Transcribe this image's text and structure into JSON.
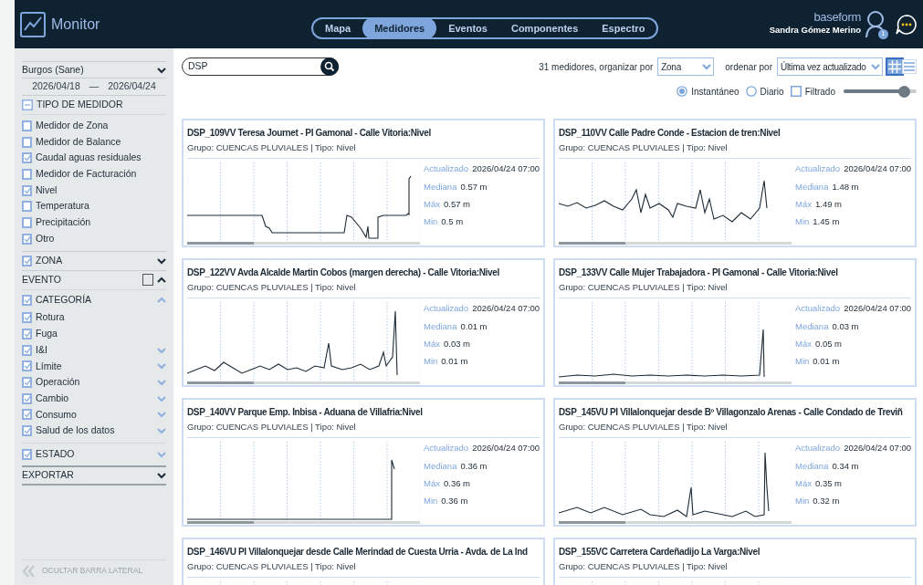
{
  "header": {
    "app_title": "Monitor",
    "nav": [
      {
        "label": "Mapa",
        "selected": false
      },
      {
        "label": "Medidores",
        "selected": true
      },
      {
        "label": "Eventos",
        "selected": false
      },
      {
        "label": "Componentes",
        "selected": false
      },
      {
        "label": "Espectro",
        "selected": false
      }
    ],
    "brand": "baseform",
    "user_name": "Sandra Gómez Merino",
    "notification_count": "1"
  },
  "sidebar": {
    "location": "Burgos (Sane)",
    "date_from": "2026/04/18",
    "date_separator": "—",
    "date_to": "2026/04/24",
    "meter_type": {
      "label": "TIPO DE MEDIDOR",
      "items": [
        {
          "label": "Medidor de Zona",
          "checked": false
        },
        {
          "label": "Medidor de Balance",
          "checked": false
        },
        {
          "label": "Caudal aguas residuales",
          "checked": true
        },
        {
          "label": "Medidor de Facturación",
          "checked": false
        },
        {
          "label": "Nivel",
          "checked": true
        },
        {
          "label": "Temperatura",
          "checked": false
        },
        {
          "label": "Precipitación",
          "checked": false
        },
        {
          "label": "Otro",
          "checked": true
        }
      ]
    },
    "zone": {
      "label": "ZONA",
      "checked": true
    },
    "event": {
      "label": "EVENTO",
      "checked": false
    },
    "category": {
      "label": "CATEGORÍA",
      "checked": true,
      "items": [
        {
          "label": "Rotura",
          "checked": true,
          "expandable": false
        },
        {
          "label": "Fuga",
          "checked": true,
          "expandable": false
        },
        {
          "label": "I&I",
          "checked": true,
          "expandable": true
        },
        {
          "label": "Límite",
          "checked": true,
          "expandable": true
        },
        {
          "label": "Operación",
          "checked": true,
          "expandable": true
        },
        {
          "label": "Cambio",
          "checked": true,
          "expandable": true
        },
        {
          "label": "Consumo",
          "checked": true,
          "expandable": true
        },
        {
          "label": "Salud de los datos",
          "checked": true,
          "expandable": true
        }
      ]
    },
    "status": {
      "label": "ESTADO",
      "checked": true
    },
    "export": {
      "label": "EXPORTAR"
    },
    "hide_sidebar": "OCULTAR BARRA LATERAL"
  },
  "toolbar": {
    "search": {
      "value": "DSP"
    },
    "count_label": "31 medidores, organizar por",
    "group_by": "Zona",
    "sort_label": "ordenar por",
    "sort_by": "Última vez actualizado",
    "view_modes": [
      {
        "kind": "grid",
        "selected": true
      },
      {
        "kind": "list",
        "selected": false
      }
    ],
    "modes": [
      {
        "kind": "radio",
        "label": "Instantáneo",
        "selected": true
      },
      {
        "kind": "radio",
        "label": "Diario",
        "selected": false
      },
      {
        "kind": "checkbox",
        "label": "Filtrado",
        "checked": false
      }
    ],
    "slider": {
      "level": 0.82
    }
  },
  "cards": [
    {
      "title": "DSP_109VV Teresa Journet - PI Gamonal - Calle Vitoria:Nivel",
      "subtitle": "Grupo: CUENCAS PLUVIALES | Tipo: Nivel",
      "stats": [
        {
          "label": "Actualizado",
          "value": "2026/04/24 07:00"
        },
        {
          "label": "Mediana",
          "value": "0.57 m"
        },
        {
          "label": "Máx",
          "value": "0.57 m"
        },
        {
          "label": "Min",
          "value": "0.5 m"
        }
      ]
    },
    {
      "title": "DSP_110VV Calle Padre Conde - Estacion de tren:Nivel",
      "subtitle": "Grupo: CUENCAS PLUVIALES | Tipo: Nivel",
      "stats": [
        {
          "label": "Actualizado",
          "value": "2026/04/24 07:00"
        },
        {
          "label": "Mediana",
          "value": "1.48 m"
        },
        {
          "label": "Máx",
          "value": "1.49 m"
        },
        {
          "label": "Min",
          "value": "1.45 m"
        }
      ]
    },
    {
      "title": "DSP_122VV Avda Alcalde Martin Cobos (margen derecha) - Calle Vitoria:Nivel",
      "subtitle": "Grupo: CUENCAS PLUVIALES | Tipo: Nivel",
      "stats": [
        {
          "label": "Actualizado",
          "value": "2026/04/24 07:00"
        },
        {
          "label": "Mediana",
          "value": "0.01 m"
        },
        {
          "label": "Máx",
          "value": "0.03 m"
        },
        {
          "label": "Min",
          "value": "0.01 m"
        }
      ]
    },
    {
      "title": "DSP_133VV Calle Mujer Trabajadora - PI Gamonal - Calle Vitoria:Nivel",
      "subtitle": "Grupo: CUENCAS PLUVIALES | Tipo: Nivel",
      "stats": [
        {
          "label": "Actualizado",
          "value": "2026/04/24 07:00"
        },
        {
          "label": "Mediana",
          "value": "0.03 m"
        },
        {
          "label": "Máx",
          "value": "0.05 m"
        },
        {
          "label": "Min",
          "value": "0.01 m"
        }
      ]
    },
    {
      "title": "DSP_140VV Parque Emp. Inbisa - Aduana de Villafria:Nivel",
      "subtitle": "Grupo: CUENCAS PLUVIALES | Tipo: Nivel",
      "stats": [
        {
          "label": "Actualizado",
          "value": "2026/04/24 07:00"
        },
        {
          "label": "Mediana",
          "value": "0.36 m"
        },
        {
          "label": "Máx",
          "value": "0.36 m"
        },
        {
          "label": "Min",
          "value": "0.36 m"
        }
      ]
    },
    {
      "title": "DSP_145VU PI Villalonquejar desde Bº Villagonzalo Arenas - Calle Condado de Treviñ",
      "subtitle": "Grupo: CUENCAS PLUVIALES | Tipo: Nivel",
      "stats": [
        {
          "label": "Actualizado",
          "value": "2026/04/24 07:00"
        },
        {
          "label": "Mediana",
          "value": "0.34 m"
        },
        {
          "label": "Máx",
          "value": "0.35 m"
        },
        {
          "label": "Min",
          "value": "0.32 m"
        }
      ]
    },
    {
      "title": "DSP_146VU PI Villalonquejar desde Calle Merindad de Cuesta Urria - Avda. de La Ind",
      "subtitle": "Grupo: CUENCAS PLUVIALES | Tipo: Nivel"
    },
    {
      "title": "DSP_155VC Carretera Cardeñadijo La Varga:Nivel",
      "subtitle": "Grupo: CUENCAS PLUVIALES | Tipo: Nivel"
    }
  ]
}
